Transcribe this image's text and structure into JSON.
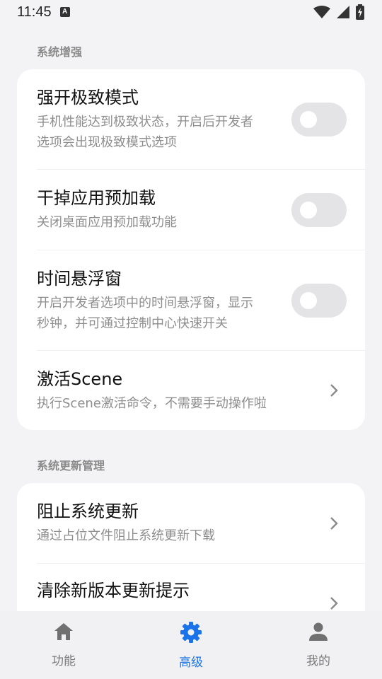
{
  "status_bar": {
    "time": "11:45",
    "notification_icon": "a-icon",
    "icons": [
      "wifi-icon",
      "signal-icon",
      "battery-charging-icon"
    ]
  },
  "sections": [
    {
      "title": "系统增强",
      "items": [
        {
          "title": "强开极致模式",
          "desc_lines": [
            "手机性能达到极致状态，开启后开发者",
            "选项会出现极致模式选项"
          ],
          "control": "toggle",
          "on": false
        },
        {
          "title": "干掉应用预加载",
          "desc_lines": [
            "关闭桌面应用预加载功能"
          ],
          "control": "toggle",
          "on": false
        },
        {
          "title": "时间悬浮窗",
          "desc_lines": [
            "开启开发者选项中的时间悬浮窗，显示",
            "秒钟，并可通过控制中心快速开关"
          ],
          "control": "toggle",
          "on": false
        },
        {
          "title": "激活Scene",
          "desc_lines": [
            "执行Scene激活命令，不需要手动操作啦"
          ],
          "control": "chevron"
        }
      ]
    },
    {
      "title": "系统更新管理",
      "items": [
        {
          "title": "阻止系统更新",
          "desc_lines": [
            "通过占位文件阻止系统更新下载"
          ],
          "control": "chevron"
        },
        {
          "title": "清除新版本更新提示",
          "desc_lines": [],
          "control": "chevron"
        }
      ]
    }
  ],
  "bottom_nav": {
    "items": [
      {
        "label": "功能",
        "icon": "home-icon",
        "active": false
      },
      {
        "label": "高级",
        "icon": "gear-icon",
        "active": true
      },
      {
        "label": "我的",
        "icon": "person-icon",
        "active": false
      }
    ]
  },
  "colors": {
    "background": "#f3f3f5",
    "card": "#ffffff",
    "accent": "#1a73e8",
    "toggle_off": "#e4e4e6",
    "secondary_text": "#8e8e8e"
  }
}
